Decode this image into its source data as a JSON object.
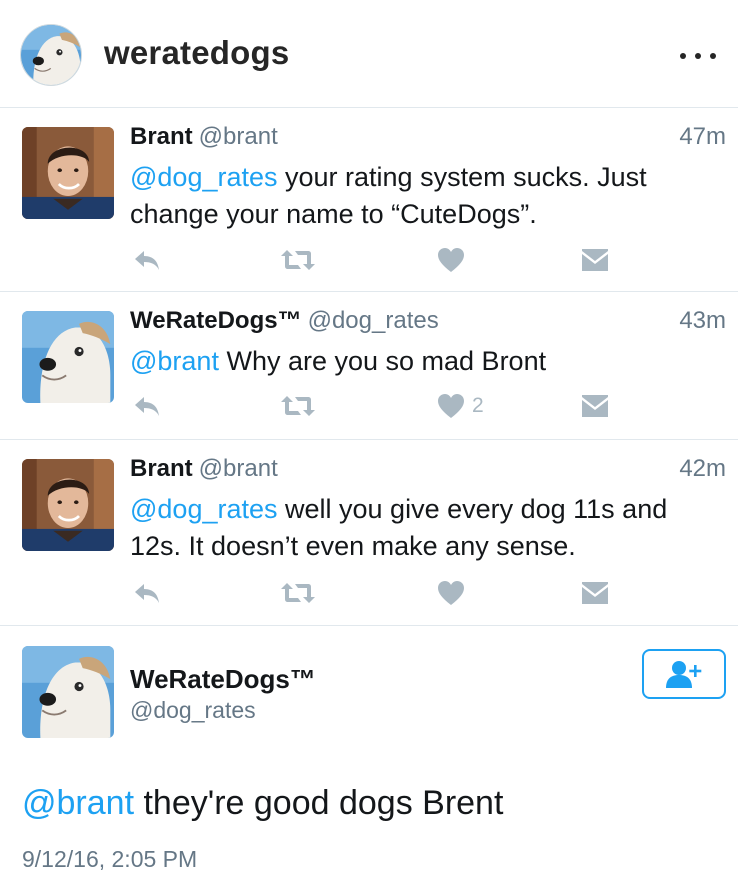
{
  "header": {
    "title": "weratedogs"
  },
  "tweets": [
    {
      "name": "Brant",
      "handle": "@brant",
      "time": "47m",
      "mention": "@dog_rates",
      "text": " your rating system sucks. Just change your name to “CuteDogs”.",
      "like_count": ""
    },
    {
      "name": "WeRateDogs™",
      "handle": "@dog_rates",
      "time": "43m",
      "mention": "@brant",
      "text": " Why are you so mad Bront",
      "like_count": "2"
    },
    {
      "name": "Brant",
      "handle": "@brant",
      "time": "42m",
      "mention": "@dog_rates",
      "text": " well you give every dog 11s and 12s. It doesn’t even make any sense.",
      "like_count": ""
    }
  ],
  "main_tweet": {
    "name": "WeRateDogs™",
    "handle": "@dog_rates",
    "mention": "@brant",
    "text": " they're good dogs Brent",
    "timestamp": "9/12/16, 2:05 PM"
  },
  "icons": {
    "reply": "reply-icon",
    "retweet": "retweet-icon",
    "like": "heart-icon",
    "dm": "envelope-icon",
    "follow": "add-user-icon",
    "more": "more-dots-icon"
  },
  "colors": {
    "accent": "#1da1f2",
    "muted": "#657786",
    "icon": "#aab8c2"
  }
}
